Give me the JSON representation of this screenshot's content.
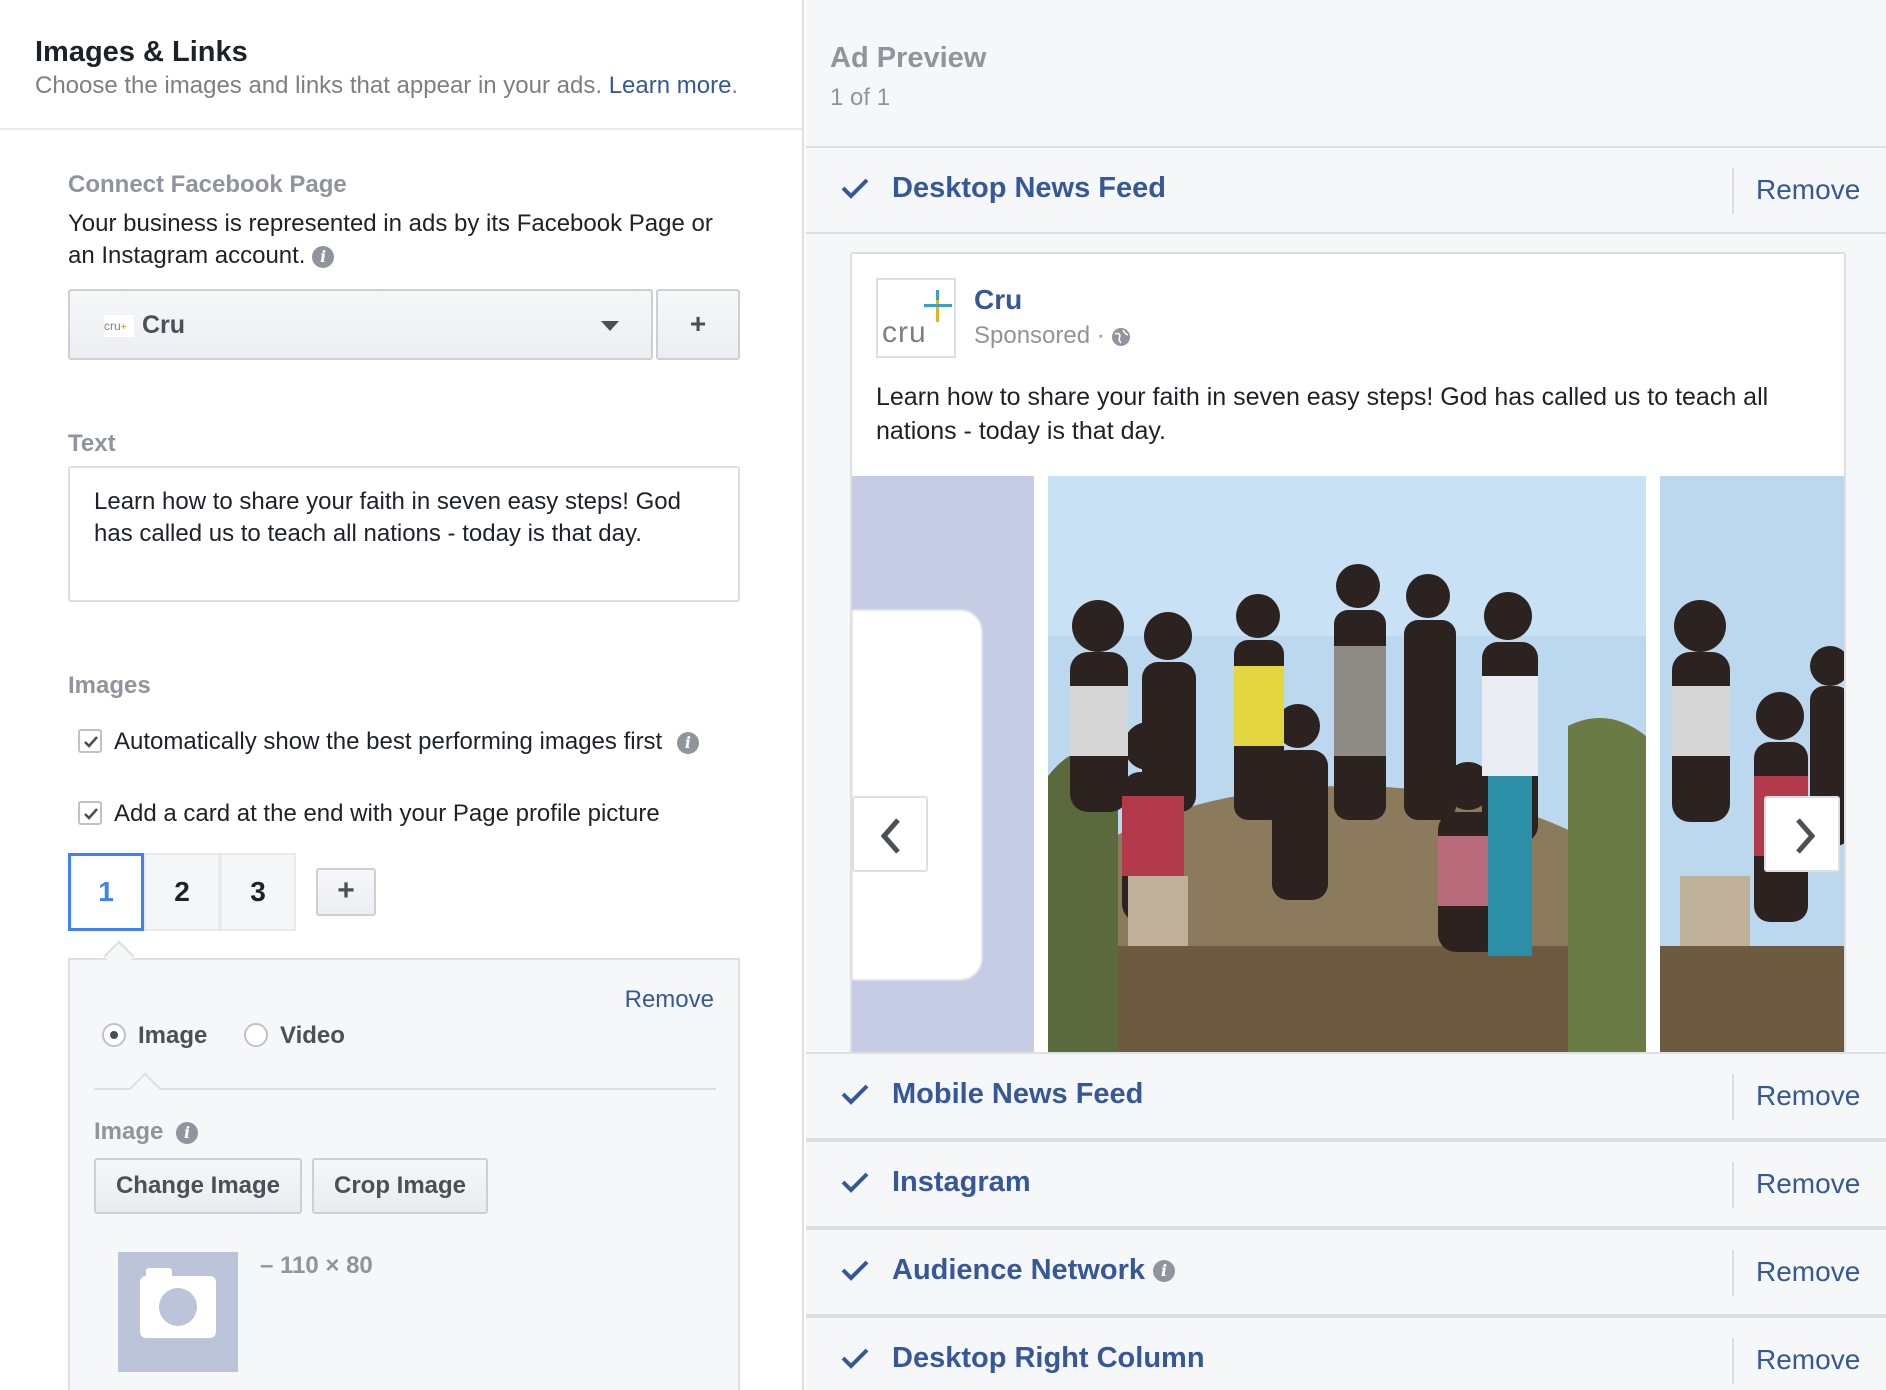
{
  "left": {
    "title": "Images & Links",
    "subtitle": "Choose the images and links that appear in your ads.",
    "learn_more": "Learn more",
    "subtitle_end": ".",
    "connect": {
      "label": "Connect Facebook Page",
      "desc_line1": "Your business is represented in ads by its Facebook Page or",
      "desc_line2": "an Instagram account.",
      "page_name": "Cru",
      "page_logo_text": "cru",
      "add": "+"
    },
    "text": {
      "label": "Text",
      "value": "Learn how to share your faith in seven easy steps! God has called us to teach all nations - today is that day."
    },
    "images": {
      "label": "Images",
      "opt1": "Automatically show the best performing images first",
      "opt2": "Add a card at the end with your Page profile picture",
      "cards": [
        "1",
        "2",
        "3"
      ],
      "add_card": "+",
      "remove": "Remove",
      "radio_image": "Image",
      "radio_video": "Video",
      "image_label": "Image",
      "change_image": "Change Image",
      "crop_image": "Crop Image",
      "dims": "– 110 × 80"
    }
  },
  "right": {
    "title": "Ad Preview",
    "count": "1 of 1",
    "remove": "Remove",
    "placements": [
      "Desktop News Feed",
      "Mobile News Feed",
      "Instagram",
      "Audience Network",
      "Desktop Right Column"
    ],
    "post": {
      "page_name": "Cru",
      "sponsored": "Sponsored ·",
      "avatar_text": "cru",
      "text": "Learn how to share your faith in seven easy steps! God has called us to teach all nations - today is that day."
    }
  },
  "colors": {
    "link": "#365899",
    "accent": "#4080ff",
    "muted": "#90949c",
    "photo_sky": "#bcd8ef"
  }
}
